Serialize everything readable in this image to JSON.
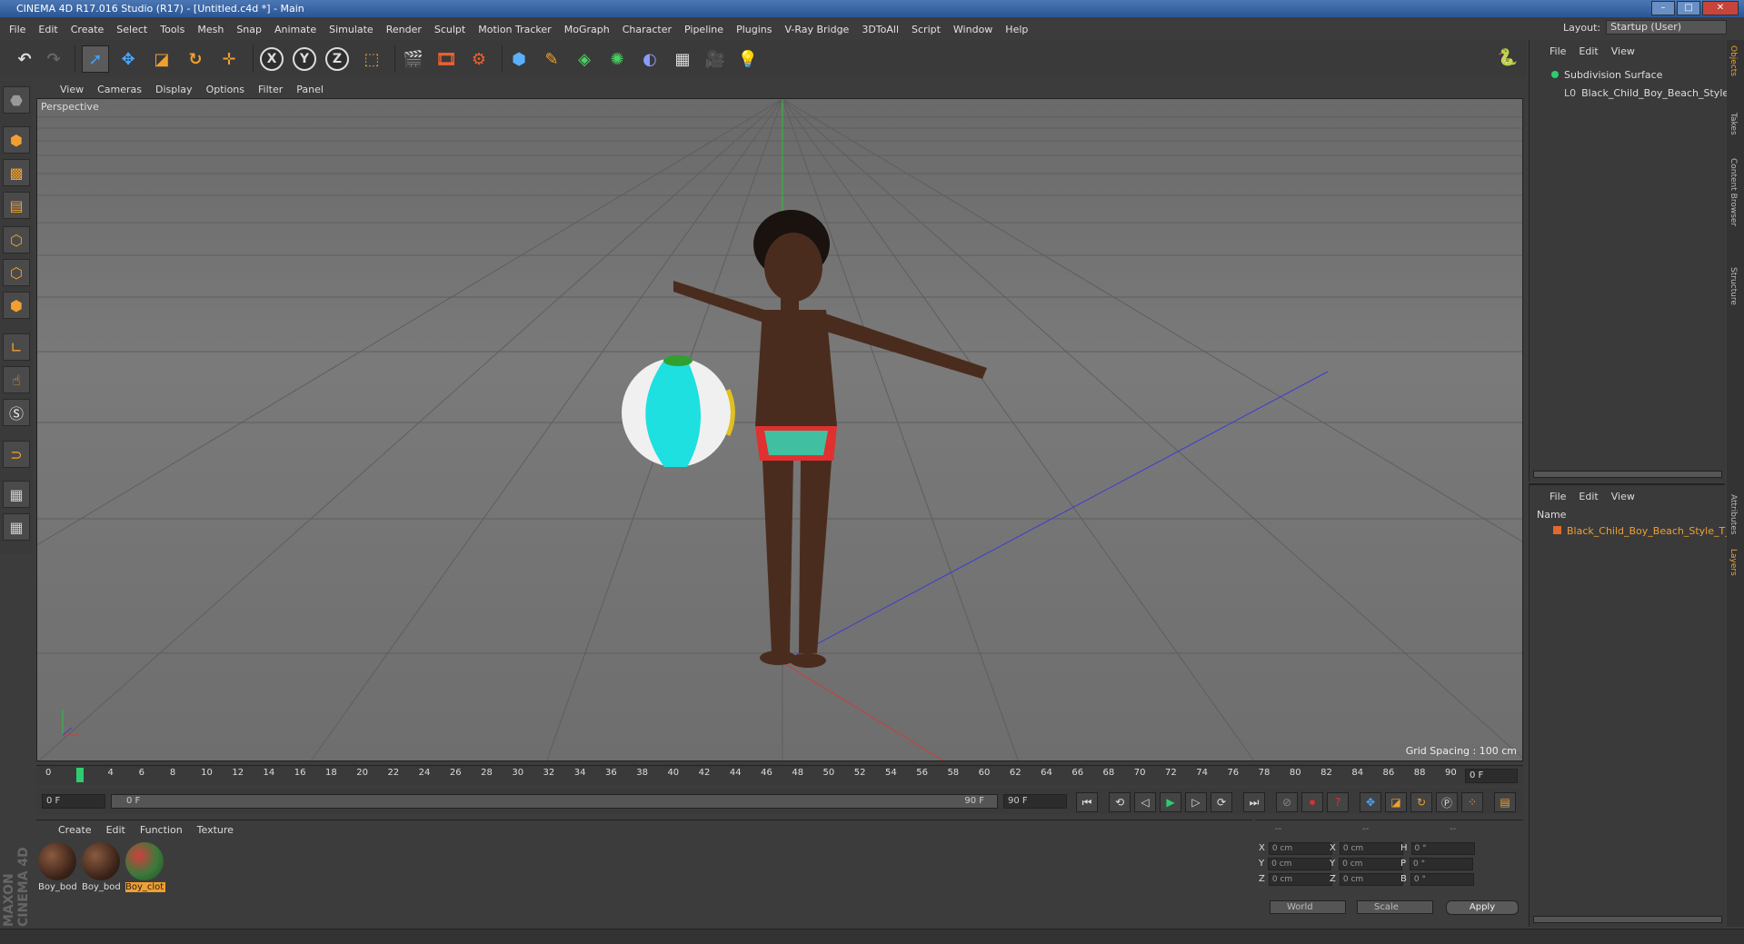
{
  "window": {
    "title": "CINEMA 4D R17.016 Studio (R17) - [Untitled.c4d *] - Main"
  },
  "menu": [
    "File",
    "Edit",
    "Create",
    "Select",
    "Tools",
    "Mesh",
    "Snap",
    "Animate",
    "Simulate",
    "Render",
    "Sculpt",
    "Motion Tracker",
    "MoGraph",
    "Character",
    "Pipeline",
    "Plugins",
    "V-Ray Bridge",
    "3DToAll",
    "Script",
    "Window",
    "Help"
  ],
  "layout": {
    "label": "Layout:",
    "value": "Startup (User)"
  },
  "toolbar": {
    "x": "X",
    "y": "Y",
    "z": "Z"
  },
  "viewport": {
    "menu": [
      "View",
      "Cameras",
      "Display",
      "Options",
      "Filter",
      "Panel"
    ],
    "label": "Perspective",
    "grid_spacing": "Grid Spacing : 100 cm"
  },
  "timeline": {
    "ticks": [
      "0",
      "2",
      "4",
      "6",
      "8",
      "10",
      "12",
      "14",
      "16",
      "18",
      "20",
      "22",
      "24",
      "26",
      "28",
      "30",
      "32",
      "34",
      "36",
      "38",
      "40",
      "42",
      "44",
      "46",
      "48",
      "50",
      "52",
      "54",
      "56",
      "58",
      "60",
      "62",
      "64",
      "66",
      "68",
      "70",
      "72",
      "74",
      "76",
      "78",
      "80",
      "82",
      "84",
      "86",
      "88",
      "90"
    ],
    "current_frame": "0 F"
  },
  "transport": {
    "start": "0 F",
    "slider_start": "0 F",
    "slider_end": "90 F",
    "end": "90 F"
  },
  "materials": {
    "menu": [
      "Create",
      "Edit",
      "Function",
      "Texture"
    ],
    "items": [
      {
        "label": "Boy_bod",
        "selected": false
      },
      {
        "label": "Boy_bod",
        "selected": false
      },
      {
        "label": "Boy_clot",
        "selected": true
      }
    ]
  },
  "coords": {
    "headers": [
      "--",
      "--",
      "--"
    ],
    "rows": [
      {
        "a": "X",
        "av": "0 cm",
        "b": "X",
        "bv": "0 cm",
        "c": "H",
        "cv": "0 °"
      },
      {
        "a": "Y",
        "av": "0 cm",
        "b": "Y",
        "bv": "0 cm",
        "c": "P",
        "cv": "0 °"
      },
      {
        "a": "Z",
        "av": "0 cm",
        "b": "Z",
        "bv": "0 cm",
        "c": "B",
        "cv": "0 °"
      }
    ],
    "world": "World",
    "scale": "Scale",
    "apply": "Apply"
  },
  "objects": {
    "menu": [
      "File",
      "Edit",
      "View"
    ],
    "items": [
      "Subdivision Surface",
      "Black_Child_Boy_Beach_Style_T_P"
    ]
  },
  "layers": {
    "menu": [
      "File",
      "Edit",
      "View"
    ],
    "col": "Name",
    "items": [
      "Black_Child_Boy_Beach_Style_T_Po"
    ]
  },
  "side_tabs": [
    "Objects",
    "Takes",
    "Content Browser",
    "Structure",
    "Attributes",
    "Layers"
  ],
  "brand": "MAXON CINEMA 4D",
  "colors": {
    "accent": "#f0a030",
    "select_green": "#2ecc71",
    "title_blue": "#2b5595"
  }
}
